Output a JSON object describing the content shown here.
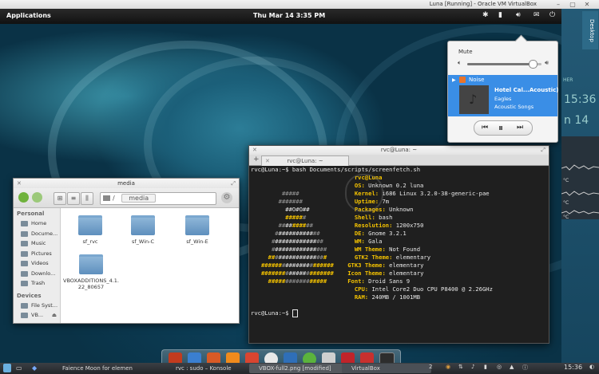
{
  "host_window": {
    "title": "Luna [Running] - Oracle VM VirtualBox",
    "minimize": "–",
    "maximize": "▢",
    "close": "✕"
  },
  "guest_panel": {
    "applications": "Applications",
    "clock": "Thu Mar 14  3:35 PM"
  },
  "side_panel": {
    "desktop_label": "Desktop",
    "widget_time": "15:36",
    "widget_day": "n 14",
    "widget_weather": "HER",
    "widget_temp1": "°C",
    "widget_temp2": "°C",
    "widget_temp3": "°C"
  },
  "sound_menu": {
    "mute_label": "Mute",
    "volume_fraction": 0.88,
    "player_name": "Noise",
    "track_title": "Hotel Cal...Acoustic)",
    "track_artist": "Eagles",
    "track_album": "Acoustic Songs"
  },
  "file_manager": {
    "title": "media",
    "path_root": "/",
    "path_current": "media",
    "sidebar_sections": [
      {
        "heading": "Personal",
        "items": [
          "Home",
          "Docume...",
          "Music",
          "Pictures",
          "Videos",
          "Downlo...",
          "Trash"
        ]
      },
      {
        "heading": "Devices",
        "items": [
          "File Syst...",
          "VB..."
        ]
      }
    ],
    "items": [
      "sf_rvc",
      "sf_Win-C",
      "sf_Win-E",
      "VBOXADDITIONS_4.1.22_80657"
    ]
  },
  "terminal": {
    "title": "rvc@Luna: ~",
    "tab_label": "rvc@Luna: ~",
    "add_tab": "+",
    "command_line": "rvc@Luna:~$ bash Documents/scripts/screenfetch.sh",
    "user_host": "rvc@Luna",
    "info": [
      {
        "key": "OS:",
        "value": "Unknown 0.2 luna"
      },
      {
        "key": "Kernel:",
        "value": "i686 Linux 3.2.0-38-generic-pae"
      },
      {
        "key": "Uptime:",
        "value": "7m"
      },
      {
        "key": "Packages:",
        "value": "Unknown"
      },
      {
        "key": "Shell:",
        "value": "bash"
      },
      {
        "key": "Resolution:",
        "value": "1200x750"
      },
      {
        "key": "DE:",
        "value": "Gnome 3.2.1"
      },
      {
        "key": "WM:",
        "value": "Gala"
      },
      {
        "key": "WM Theme:",
        "value": "Not Found"
      },
      {
        "key": "GTK2 Theme:",
        "value": "elementary"
      },
      {
        "key": "GTK3 Theme:",
        "value": "elementary"
      },
      {
        "key": "Icon Theme:",
        "value": "elementary"
      },
      {
        "key": "Font:",
        "value": "Droid Sans 9"
      },
      {
        "key": "CPU:",
        "value": "Intel Core2 Duo CPU P8400 @ 2.26GHz"
      },
      {
        "key": "RAM:",
        "value": "240MB / 1001MB"
      }
    ],
    "prompt": "rvc@Luna:~$"
  },
  "host_taskbar": {
    "tasks": [
      "Faience Moon for elemen",
      "rvc : sudo – Konsole",
      "VBOX-full2.png [modified]",
      "VirtualBox"
    ],
    "desktop_number": "2",
    "clock": "15:36"
  }
}
